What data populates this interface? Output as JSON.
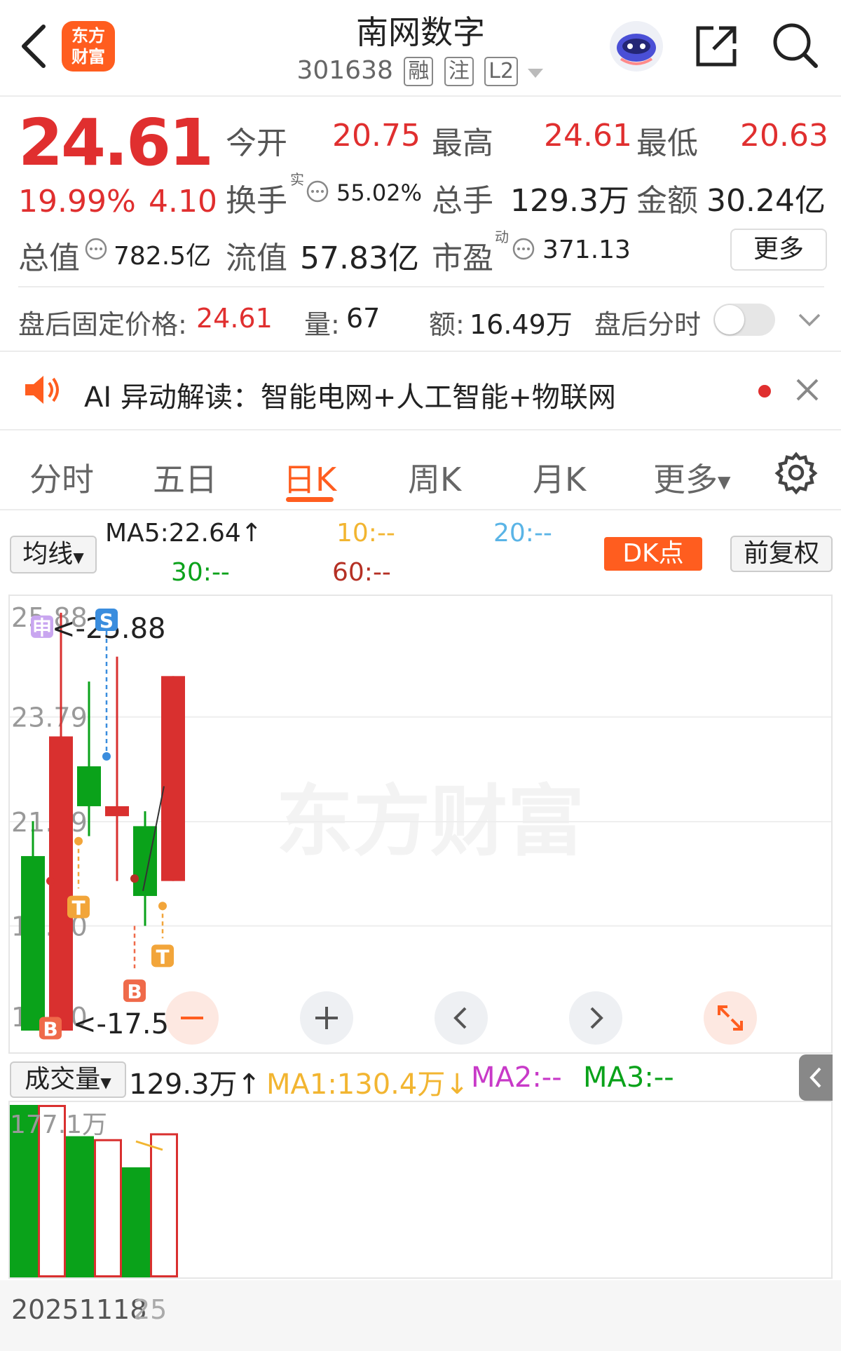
{
  "header": {
    "title": "南网数字",
    "code": "301638",
    "tags": [
      "融",
      "注",
      "L2"
    ],
    "logo_text_line1": "东方",
    "logo_text_line2": "财富"
  },
  "quote": {
    "price": "24.61",
    "change_pct": "19.99%",
    "change_amt": "4.10",
    "open_label": "今开",
    "open": "20.75",
    "high_label": "最高",
    "high": "24.61",
    "low_label": "最低",
    "low": "20.63",
    "turnover_label": "换手",
    "turnover_sup": "实",
    "turnover": "55.02%",
    "vol_label": "总手",
    "vol": "129.3万",
    "amount_label": "金额",
    "amount": "30.24亿",
    "mktcap_label": "总值",
    "mktcap": "782.5亿",
    "float_label": "流值",
    "float_cap": "57.83亿",
    "pe_label": "市盈",
    "pe_sup": "动",
    "pe": "371.13",
    "more_label": "更多"
  },
  "after_hours": {
    "price_label": "盘后固定价格:",
    "price": "24.61",
    "vol_label": "量:",
    "vol": "67",
    "amount_label": "额:",
    "amount": "16.49万",
    "timeshare_label": "盘后分时"
  },
  "ai_banner": {
    "text": "AI 异动解读：智能电网+人工智能+物联网"
  },
  "tabs": [
    {
      "label": "分时"
    },
    {
      "label": "五日"
    },
    {
      "label": "日K"
    },
    {
      "label": "周K"
    },
    {
      "label": "月K"
    },
    {
      "label": "更多"
    }
  ],
  "ma_bar": {
    "selector": "均线",
    "ma5": "MA5:22.64",
    "ma10": "10:--",
    "ma20": "20:--",
    "ma30": "30:--",
    "ma60": "60:--",
    "dk_label": "DK点",
    "adjust_label": "前复权"
  },
  "volume_bar": {
    "selector": "成交量",
    "value": "129.3万",
    "ma1": "MA1:130.4万",
    "ma2": "MA2:--",
    "ma3": "MA3:--"
  },
  "chart_data": {
    "type": "candlestick",
    "y_ticks": [
      "25.88",
      "23.79",
      "21.69",
      "19.60",
      "17.50"
    ],
    "ylim": [
      17.5,
      25.88
    ],
    "max_label": "<-25.88",
    "min_label": "<-17.50",
    "candles": [
      {
        "open": 21.0,
        "close": 17.5,
        "high": 21.7,
        "low": 17.5,
        "dir": "down"
      },
      {
        "open": 17.5,
        "close": 23.4,
        "high": 25.88,
        "low": 17.5,
        "dir": "up"
      },
      {
        "open": 22.8,
        "close": 22.0,
        "high": 24.5,
        "low": 21.4,
        "dir": "down"
      },
      {
        "open": 22.0,
        "close": 21.8,
        "high": 25.0,
        "low": 20.5,
        "dir": "up"
      },
      {
        "open": 21.6,
        "close": 20.2,
        "high": 21.9,
        "low": 19.6,
        "dir": "down"
      },
      {
        "open": 20.5,
        "close": 24.61,
        "high": 24.61,
        "low": 20.5,
        "dir": "up"
      }
    ],
    "markers": [
      "S",
      "T",
      "T",
      "B",
      "B",
      "申"
    ],
    "volume": {
      "max_tick": "177.1万",
      "values": [
        177.1,
        177.1,
        145,
        142,
        113,
        148
      ],
      "dir": [
        "down",
        "up",
        "down",
        "up",
        "down",
        "up"
      ]
    },
    "x_labels": [
      "20251118",
      "25"
    ],
    "watermark": "东方财富"
  },
  "colors": {
    "up": "#d9302f",
    "down": "#0aa21a",
    "accent": "#ff5d1f"
  }
}
